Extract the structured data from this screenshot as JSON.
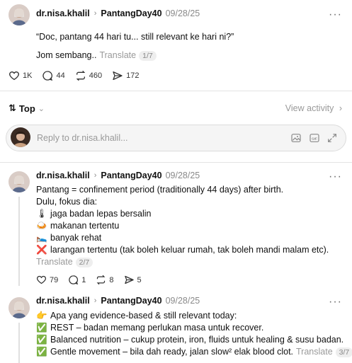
{
  "main_post": {
    "username": "dr.nisa.khalil",
    "topic": "PantangDay40",
    "date": "09/28/25",
    "text": "“Doc, pantang 44 hari tu... still relevant ke hari ni?”",
    "sub": "Jom sembang..",
    "translate": "Translate",
    "badge": "1/7",
    "likes": "1K",
    "comments": "44",
    "reposts": "460",
    "shares": "172"
  },
  "sort": {
    "label": "Top",
    "view_activity": "View activity"
  },
  "reply_box": {
    "placeholder": "Reply to dr.nisa.khalil..."
  },
  "reply1": {
    "username": "dr.nisa.khalil",
    "topic": "PantangDay40",
    "date": "09/28/25",
    "line1": "Pantang = confinement period (traditionally 44 days) after birth.",
    "line2": "Dulu, fokus dia:",
    "item1_icon": "🌡",
    "item1": "jaga badan lepas bersalin",
    "item2_icon": "🍛",
    "item2": "makanan tertentu",
    "item3_icon": "🛌",
    "item3": "banyak rehat",
    "item4_icon": "❌",
    "item4": "larangan tertentu (tak boleh keluar rumah, tak boleh mandi malam etc).",
    "translate": "Translate",
    "badge": "2/7",
    "likes": "79",
    "comments": "1",
    "reposts": "8",
    "shares": "5"
  },
  "reply2": {
    "username": "dr.nisa.khalil",
    "topic": "PantangDay40",
    "date": "09/28/25",
    "line1_icon": "👉",
    "line1": "Apa yang evidence-based & still relevant today:",
    "item1_icon": "✅",
    "item1": "REST – badan memang perlukan masa untuk recover.",
    "item2_icon": "✅",
    "item2": "Balanced nutrition – cukup protein, iron, fluids untuk healing & susu badan.",
    "item3_icon": "✅",
    "item3": "Gentle movement – bila dah ready, jalan slow² elak blood clot.",
    "translate": "Translate",
    "badge": "3/7"
  },
  "colors": {
    "accent_green": "#2e9b3a",
    "muted": "#8a8a8a",
    "divider": "#e4e4e4"
  },
  "icons": [
    "heart-icon",
    "comment-icon",
    "repost-icon",
    "share-icon",
    "more-icon",
    "sort-icon",
    "image-icon",
    "gif-icon",
    "expand-icon"
  ]
}
